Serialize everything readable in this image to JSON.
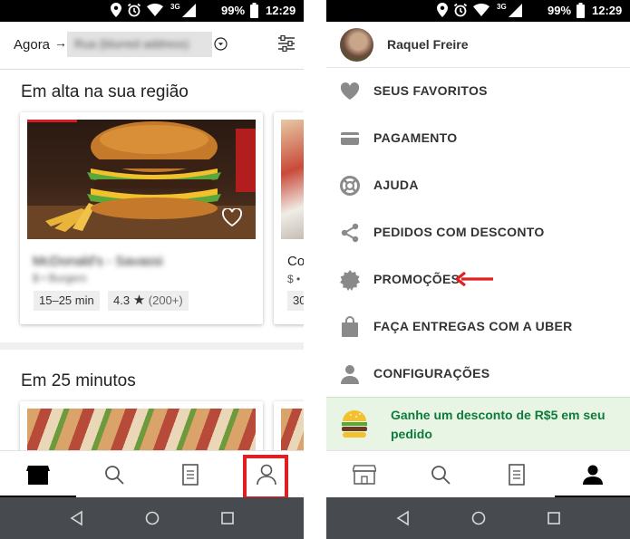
{
  "colors": {
    "accent_green": "#0f7b3b",
    "promo_bg": "#e8f5e4",
    "highlight_red": "#e02020",
    "navbar_gray": "#474a4f",
    "icon_gray": "#8a8a8a"
  },
  "left": {
    "status": {
      "network": "3G",
      "battery": "99%",
      "time": "12:29"
    },
    "location": {
      "label": "Agora",
      "address": "Rua (blurred address)"
    },
    "sections": [
      {
        "title": "Em alta na sua região",
        "restaurants": [
          {
            "name": "McDonald's - Savassi",
            "category": "$ • Burgers",
            "eta": "15–25 min",
            "rating": "4.3",
            "reviews": "(200+)"
          },
          {
            "name": "Co",
            "category": "$ •",
            "eta": "30"
          }
        ]
      },
      {
        "title": "Em 25 minutos"
      }
    ],
    "bottom_tabs": [
      {
        "id": "home",
        "icon": "store-icon"
      },
      {
        "id": "search",
        "icon": "search-icon"
      },
      {
        "id": "orders",
        "icon": "receipt-icon"
      },
      {
        "id": "account",
        "icon": "person-icon",
        "highlighted": true
      }
    ]
  },
  "right": {
    "status": {
      "network": "3G",
      "battery": "99%",
      "time": "12:29"
    },
    "profile": {
      "name": "Raquel Freire"
    },
    "menu": [
      {
        "icon": "heart-icon",
        "label": "SEUS FAVORITOS"
      },
      {
        "icon": "credit-card-icon",
        "label": "PAGAMENTO"
      },
      {
        "icon": "help-lifebuoy-icon",
        "label": "AJUDA"
      },
      {
        "icon": "share-icon",
        "label": "PEDIDOS COM DESCONTO"
      },
      {
        "icon": "promo-badge-icon",
        "label": "PROMOÇÕES",
        "annotated": true
      },
      {
        "icon": "shopping-bag-icon",
        "label": "FAÇA ENTREGAS COM A UBER"
      },
      {
        "icon": "person-icon",
        "label": "CONFIGURAÇÕES"
      }
    ],
    "promo": {
      "text": "Ganhe um desconto de R$5 em seu pedido"
    },
    "bottom_tabs": [
      {
        "id": "home",
        "icon": "store-icon"
      },
      {
        "id": "search",
        "icon": "search-icon"
      },
      {
        "id": "orders",
        "icon": "receipt-icon"
      },
      {
        "id": "account",
        "icon": "person-icon",
        "active": true
      }
    ]
  }
}
